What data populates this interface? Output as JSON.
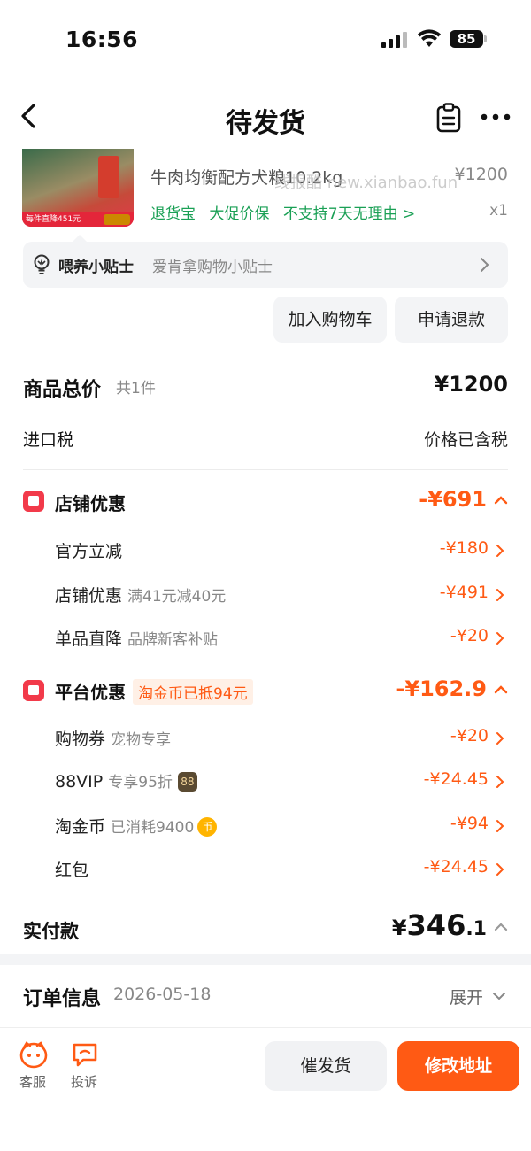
{
  "status_bar": {
    "time": "16:56",
    "battery": "85"
  },
  "nav": {
    "title": "待发货"
  },
  "product": {
    "name": "牛肉均衡配方犬粮10.2kg",
    "price": "¥1200",
    "qty": "x1",
    "tags": [
      "退货宝",
      "大促价保",
      "不支持7天无理由 >"
    ],
    "image_strip_text": "每件直降451元",
    "watermark": "线报酷 new.xianbao.fun"
  },
  "tip": {
    "label": "喂养小贴士",
    "text": "爱肯拿购物小贴士"
  },
  "actions": {
    "add_cart": "加入购物车",
    "refund": "申请退款"
  },
  "summary": {
    "total_label": "商品总价",
    "total_count": "共1件",
    "total_value": "¥1200",
    "tax_label": "进口税",
    "tax_value": "价格已含税"
  },
  "shop_discount": {
    "label": "店铺优惠",
    "value": "-¥691",
    "items": [
      {
        "label": "官方立减",
        "sub": "",
        "value": "-¥180"
      },
      {
        "label": "店铺优惠",
        "sub": "满41元减40元",
        "value": "-¥491"
      },
      {
        "label": "单品直降",
        "sub": "品牌新客补贴",
        "value": "-¥20"
      }
    ]
  },
  "platform_discount": {
    "label": "平台优惠",
    "chip": "淘金币已抵94元",
    "value": "-¥162.9",
    "items": [
      {
        "label": "购物券",
        "sub": "宠物专享",
        "value": "-¥20",
        "badge": ""
      },
      {
        "label": "88VIP",
        "sub": "专享95折",
        "value": "-¥24.45",
        "badge": "88"
      },
      {
        "label": "淘金币",
        "sub": "已消耗9400",
        "value": "-¥94",
        "badge": "币"
      },
      {
        "label": "红包",
        "sub": "",
        "value": "-¥24.45",
        "badge": ""
      }
    ]
  },
  "paid": {
    "label": "实付款",
    "currency": "¥",
    "integer": "346",
    "decimal": ".1"
  },
  "order_info": {
    "label": "订单信息",
    "date": "2026-05-18",
    "expand": "展开"
  },
  "bottom": {
    "service": "客服",
    "complain": "投诉",
    "urge": "催发货",
    "modify": "修改地址"
  },
  "colors": {
    "accent": "#ff5a14",
    "green": "#1aa055",
    "red_badge": "#f23a4a"
  }
}
